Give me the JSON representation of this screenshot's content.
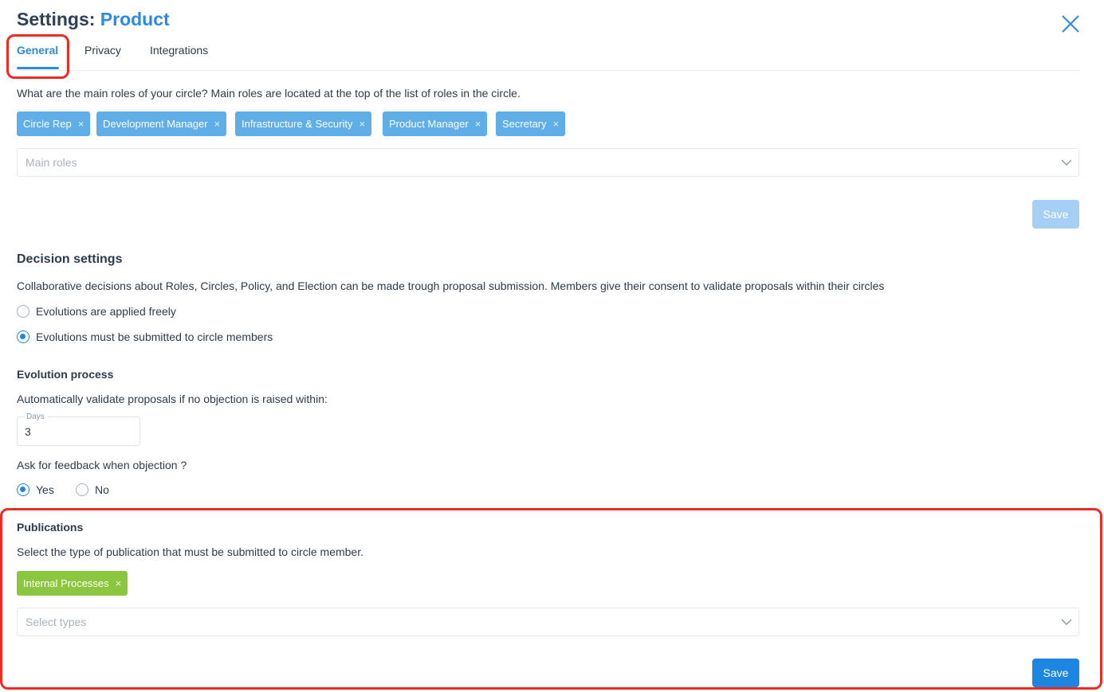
{
  "header": {
    "title_prefix": "Settings:",
    "title_accent": "Product",
    "close_icon": "close-icon"
  },
  "tabs": [
    {
      "label": "General",
      "active": true
    },
    {
      "label": "Privacy",
      "active": false
    },
    {
      "label": "Integrations",
      "active": false
    }
  ],
  "main_roles": {
    "question": "What are the main roles of your circle? Main roles are located at the top of the list of roles in the circle.",
    "chips": [
      "Circle Rep",
      "Development Manager",
      "Infrastructure & Security",
      "Product Manager",
      "Secretary"
    ],
    "chip_remove_glyph": "×",
    "placeholder": "Main roles",
    "save_label": "Save"
  },
  "decision": {
    "heading": "Decision settings",
    "description": "Collaborative decisions about Roles, Circles, Policy, and Election can be made trough proposal submission. Members give their consent to validate proposals within their circles",
    "options": [
      {
        "label": "Evolutions are applied freely",
        "checked": false
      },
      {
        "label": "Evolutions must be submitted to circle members",
        "checked": true
      }
    ]
  },
  "evolution": {
    "heading": "Evolution process",
    "description": "Automatically validate proposals if no objection is raised within:",
    "days_label": "Days",
    "days_value": "3",
    "feedback_question": "Ask for feedback when objection ?",
    "feedback_options": [
      {
        "label": "Yes",
        "checked": true
      },
      {
        "label": "No",
        "checked": false
      }
    ]
  },
  "publications": {
    "heading": "Publications",
    "description": "Select the type of publication that must be submitted to circle member.",
    "chips": [
      "Internal Processes"
    ],
    "placeholder": "Select types",
    "save_label": "Save"
  },
  "colors": {
    "accent": "#2a8be4",
    "chip_blue": "#5faee8",
    "chip_green": "#8cc63f",
    "highlight": "#ee2a24"
  }
}
